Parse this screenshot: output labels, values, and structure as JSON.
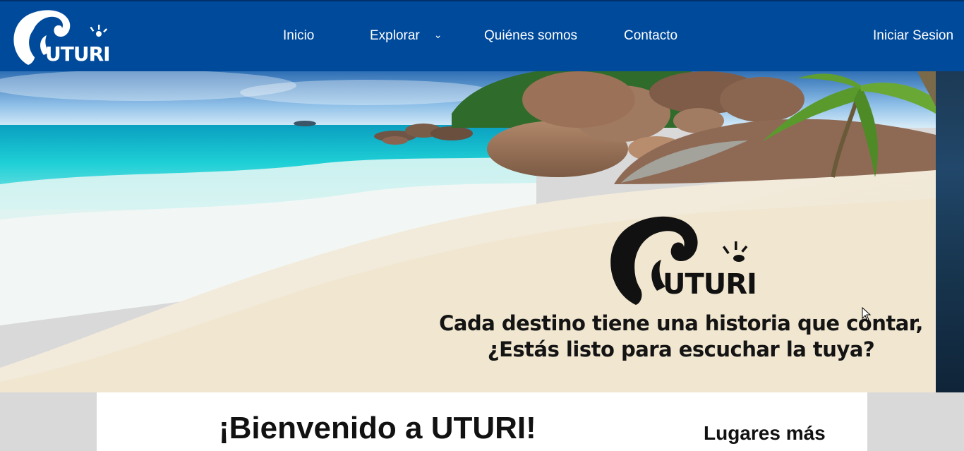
{
  "brand": {
    "logo_text": "UTURI",
    "colors": {
      "nav_bg": "#004a9c",
      "white": "#ffffff"
    }
  },
  "nav": {
    "inicio": "Inicio",
    "explorar": "Explorar",
    "explorar_icon": "chevron-down-icon",
    "quienes": "Quiénes somos",
    "contacto": "Contacto",
    "login": "Iniciar Sesion"
  },
  "hero": {
    "logo_text": "UTURI",
    "tagline_line1": "Cada destino tiene una historia que contar,",
    "tagline_line2": "¿Estás listo para escuchar la tuya?"
  },
  "main": {
    "welcome_title": "¡Bienvenido a UTURI!",
    "side_heading": "Lugares más"
  }
}
